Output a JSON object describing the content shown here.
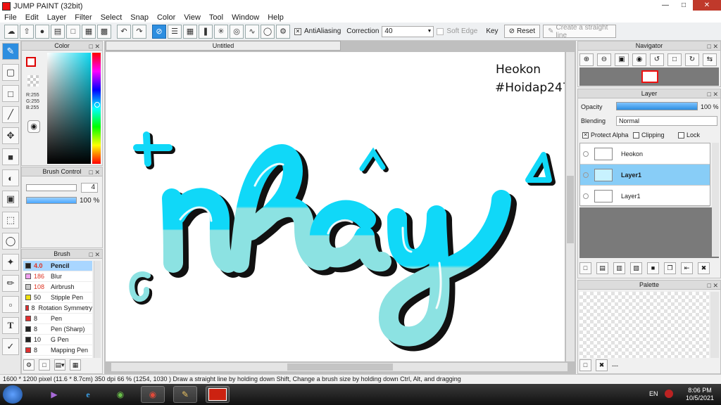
{
  "window": {
    "title": "JUMP PAINT (32bit)"
  },
  "menu": [
    "File",
    "Edit",
    "Layer",
    "Filter",
    "Select",
    "Snap",
    "Color",
    "View",
    "Tool",
    "Window",
    "Help"
  ],
  "toolbar": {
    "antialiasing_label": "AntiAliasing",
    "correction_label": "Correction",
    "correction_value": "40",
    "soft_edge_label": "Soft Edge",
    "key_label": "Key",
    "reset_label": "Reset",
    "straight_line_label": "Create a straight line"
  },
  "color_panel": {
    "title": "Color",
    "r": "R:255",
    "g": "G:255",
    "b": "B:255"
  },
  "brush_control": {
    "title": "Brush Control",
    "size": "4",
    "opacity": "100 %",
    "opacity_fraction": 1.0
  },
  "brush_panel": {
    "title": "Brush",
    "items": [
      {
        "size": "4.0",
        "name": "Pencil",
        "color": "#222222",
        "selected": true,
        "red": true
      },
      {
        "size": "186",
        "name": "Blur",
        "color": "#f0a0f0",
        "selected": false,
        "red": true
      },
      {
        "size": "108",
        "name": "Airbrush",
        "color": "#c8c8c8",
        "selected": false,
        "red": true
      },
      {
        "size": "50",
        "name": "Stipple Pen",
        "color": "#f0e010",
        "selected": false,
        "red": false
      },
      {
        "size": "8",
        "name": "Rotation Symmetry",
        "color": "#e03030",
        "selected": false,
        "red": false
      },
      {
        "size": "8",
        "name": "Pen",
        "color": "#e03030",
        "selected": false,
        "red": false
      },
      {
        "size": "8",
        "name": "Pen (Sharp)",
        "color": "#222222",
        "selected": false,
        "red": false
      },
      {
        "size": "10",
        "name": "G Pen",
        "color": "#222222",
        "selected": false,
        "red": false
      },
      {
        "size": "8",
        "name": "Mapping Pen",
        "color": "#e03030",
        "selected": false,
        "red": false
      }
    ]
  },
  "document": {
    "tab_title": "Untitled",
    "canvas_text_1": "Heokon",
    "canvas_text_2": "#Hoidap247",
    "lettering": "nhây"
  },
  "navigator": {
    "title": "Navigator"
  },
  "layer_panel": {
    "title": "Layer",
    "opacity_label": "Opacity",
    "opacity_value": "100 %",
    "blending_label": "Blending",
    "blending_value": "Normal",
    "protect_alpha_label": "Protect Alpha",
    "clipping_label": "Clipping",
    "lock_label": "Lock",
    "layers": [
      {
        "name": "Heokon",
        "selected": false
      },
      {
        "name": "Layer1",
        "selected": true
      },
      {
        "name": "Layer1",
        "selected": false
      }
    ]
  },
  "palette_panel": {
    "title": "Palette",
    "footer_text": "---"
  },
  "status": {
    "text": "1600 * 1200 pixel   (11.6 * 8.7cm)   350 dpi   66 %   (1254, 1030 )   Draw a straight line by holding down Shift, Change a brush size by holding down Ctrl, Alt, and dragging"
  },
  "taskbar": {
    "lang": "EN",
    "time": "8:06 PM",
    "date": "10/5/2021"
  },
  "colors": {
    "accent": "#2d8ee0",
    "lettering": "#10d8f8",
    "lettering_light": "#8ce0e0"
  }
}
